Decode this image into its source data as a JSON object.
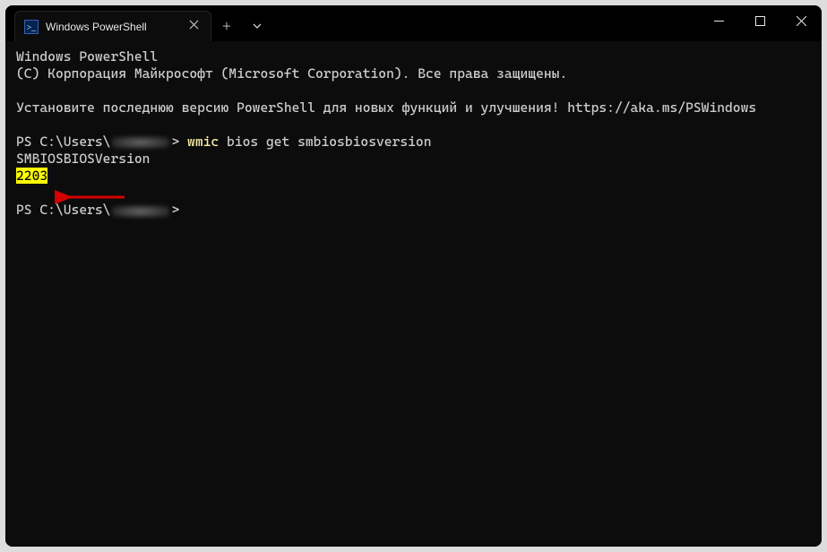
{
  "titlebar": {
    "tab_title": "Windows PowerShell"
  },
  "terminal": {
    "line1": "Windows PowerShell",
    "line2": "(C) Корпорация Майкрософт (Microsoft Corporation). Все права защищены.",
    "line4": "Установите последнюю версию PowerShell для новых функций и улучшения! https://aka.ms/PSWindows",
    "prompt_prefix": "PS C:\\Users\\",
    "prompt_suffix": "> ",
    "command_word": "wmic",
    "command_rest": " bios get smbiosbiosversion",
    "output_header": "SMBIOSBIOSVersion",
    "output_value": "2203"
  }
}
